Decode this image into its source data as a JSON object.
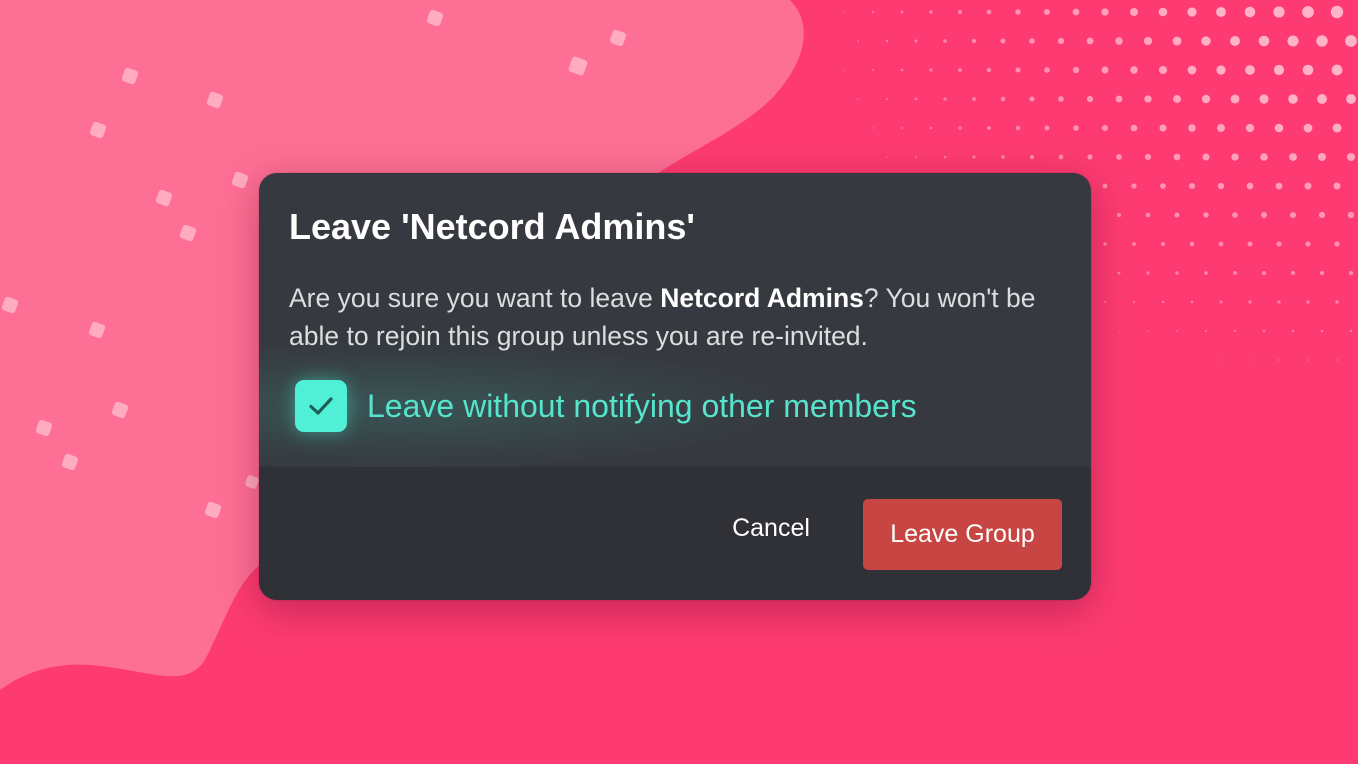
{
  "dialog": {
    "title": "Leave 'Netcord Admins'",
    "message_prefix": "Are you sure you want to leave ",
    "group_name": "Netcord Admins",
    "message_suffix": "? You won't be able to rejoin this group unless you are re-invited.",
    "checkbox": {
      "label": "Leave without notifying other members",
      "checked": true,
      "icon": "checkmark-icon"
    },
    "cancel_label": "Cancel",
    "confirm_label": "Leave Group"
  },
  "colors": {
    "background_pink": "#fd3b72",
    "background_blob": "#fe6f95",
    "dialog_background": "#36393f",
    "footer_background": "#2f3136",
    "checkbox_accent": "#4ff0d5",
    "danger_button": "#c74643"
  }
}
